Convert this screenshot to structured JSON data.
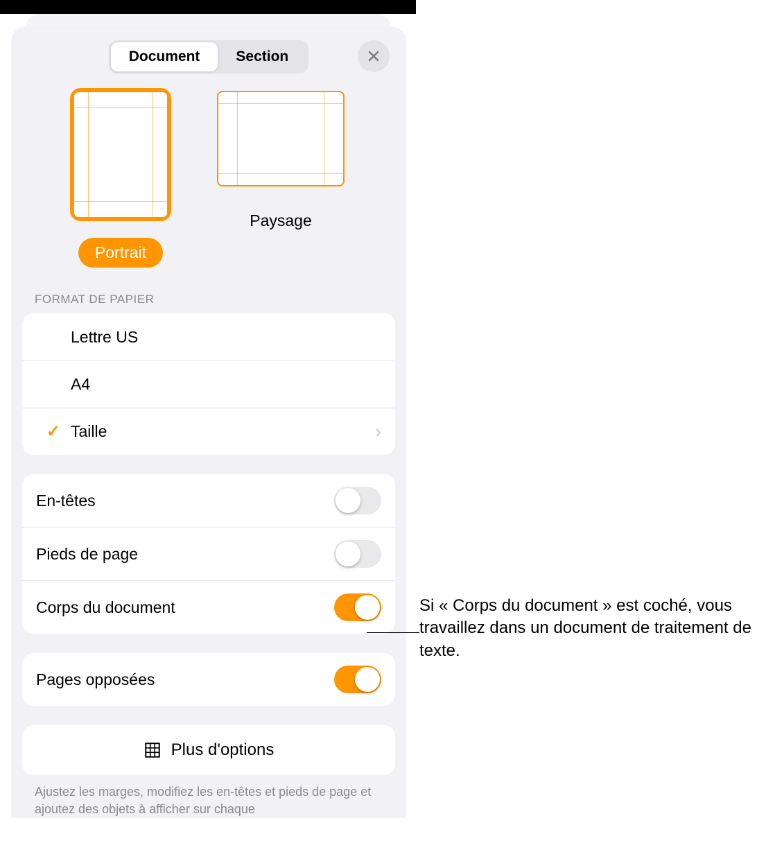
{
  "tabs": {
    "document": "Document",
    "section": "Section"
  },
  "orientation": {
    "portrait": "Portrait",
    "landscape": "Paysage"
  },
  "paper": {
    "title": "FORMAT DE PAPIER",
    "options": {
      "letter": "Lettre US",
      "a4": "A4",
      "size": "Taille"
    }
  },
  "toggles": {
    "headers": "En-têtes",
    "footers": "Pieds de page",
    "body": "Corps du document",
    "facing": "Pages opposées"
  },
  "more": "Plus d'options",
  "hint": "Ajustez les marges, modifiez les en-têtes et pieds de page et ajoutez des objets à afficher sur chaque",
  "callout": "Si « Corps du document » est coché, vous travaillez dans un document de traitement de texte."
}
